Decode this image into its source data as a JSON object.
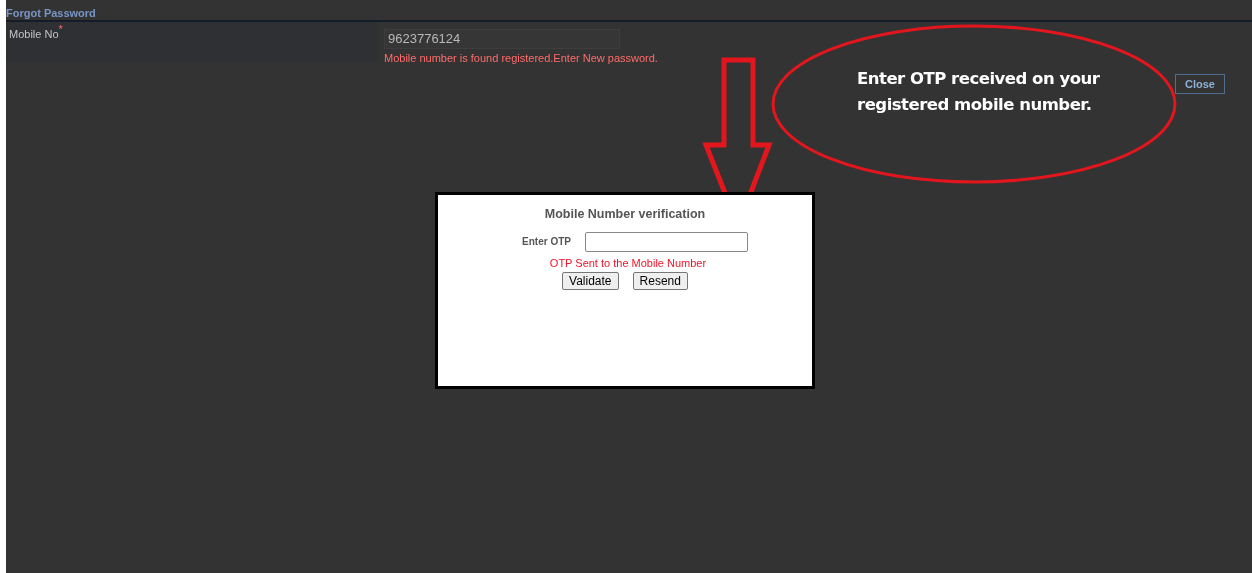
{
  "form": {
    "title": "Forgot Password",
    "field": {
      "label": "Mobile No",
      "required_mark": "*",
      "value": "9623776124",
      "message": "Mobile number is found registered.Enter New password."
    },
    "close_button": "Close"
  },
  "annotation": {
    "text": "Enter OTP received on your registered mobile number."
  },
  "dialog": {
    "title": "Mobile Number verification",
    "otp_label": "Enter OTP",
    "message": "OTP Sent to the Mobile Number",
    "buttons": [
      "Validate",
      "Resend"
    ]
  }
}
